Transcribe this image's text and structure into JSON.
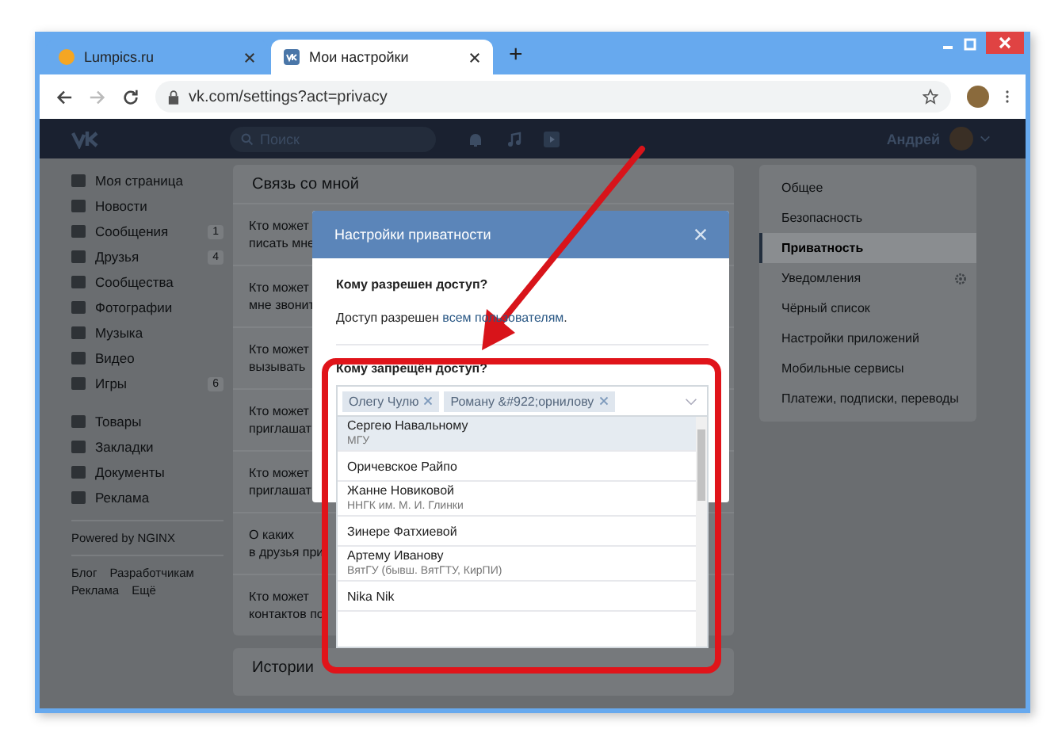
{
  "browser": {
    "tabs": [
      {
        "title": "Lumpics.ru",
        "selected": false
      },
      {
        "title": "Мои настройки",
        "selected": true
      }
    ],
    "new_tab": "+",
    "url": "vk.com/settings?act=privacy"
  },
  "header": {
    "search_placeholder": "Поиск",
    "user_name": "Андрей"
  },
  "left_nav": {
    "items": [
      {
        "label": "Моя страница"
      },
      {
        "label": "Новости"
      },
      {
        "label": "Сообщения",
        "badge": "1"
      },
      {
        "label": "Друзья",
        "badge": "4"
      },
      {
        "label": "Сообщества"
      },
      {
        "label": "Фотографии"
      },
      {
        "label": "Музыка"
      },
      {
        "label": "Видео"
      },
      {
        "label": "Игры",
        "badge": "6"
      }
    ],
    "items_2": [
      {
        "label": "Товары"
      },
      {
        "label": "Закладки"
      },
      {
        "label": "Документы"
      },
      {
        "label": "Реклама"
      }
    ],
    "powered": "Powered by NGINX",
    "footer_links": [
      "Блог",
      "Разработчикам",
      "Реклама",
      "Ещё"
    ]
  },
  "settings_card": {
    "title": "Связь со мной",
    "rows": [
      {
        "lines": [
          "Кто может",
          "писать мне"
        ]
      },
      {
        "lines": [
          "Кто может",
          "мне звонит"
        ]
      },
      {
        "lines": [
          "Кто может",
          "вызывать"
        ]
      },
      {
        "lines": [
          "Кто может",
          "приглашат"
        ]
      },
      {
        "lines": [
          "Кто может",
          "приглашат"
        ]
      },
      {
        "lines": [
          "О каких",
          "в друзья при"
        ]
      },
      {
        "lines": [
          "Кто может",
          "контактов по"
        ]
      }
    ]
  },
  "stories_card": {
    "title": "Истории"
  },
  "settings_menu": {
    "items": [
      {
        "label": "Общее",
        "selected": false,
        "gear": false
      },
      {
        "label": "Безопасность",
        "selected": false,
        "gear": false
      },
      {
        "label": "Приватность",
        "selected": true,
        "gear": false
      },
      {
        "label": "Уведомления",
        "selected": false,
        "gear": true
      },
      {
        "label": "Чёрный список",
        "selected": false,
        "gear": false
      },
      {
        "label": "Настройки приложений",
        "selected": false,
        "gear": false
      },
      {
        "label": "Мобильные сервисы",
        "selected": false,
        "gear": false
      },
      {
        "label": "Платежи, подписки, переводы",
        "selected": false,
        "gear": false
      }
    ]
  },
  "modal": {
    "title": "Настройки приватности",
    "allowed_heading": "Кому разрешен доступ?",
    "allowed_text": "Доступ разрешен ",
    "allowed_link": "всем пользователям",
    "allowed_end": ".",
    "denied_heading": "Кому запрещён доступ?",
    "tokens": [
      "Олегу Чулю",
      "Роману &#922;орнилову"
    ],
    "options": [
      {
        "name": "Сергею Навальному",
        "detail": "МГУ",
        "selected": true
      },
      {
        "name": "Оричевское Райпо",
        "selected": false
      },
      {
        "name": "Жанне Новиковой",
        "detail": "ННГК им. М. И. Глинки",
        "selected": false
      },
      {
        "name": "Зинере Фатхиевой",
        "selected": false
      },
      {
        "name": "Артему Иванову",
        "detail": "ВятГУ (бывш. ВятГТУ, КирПИ)",
        "selected": false
      },
      {
        "name": "Nika Nik",
        "selected": false
      }
    ]
  }
}
